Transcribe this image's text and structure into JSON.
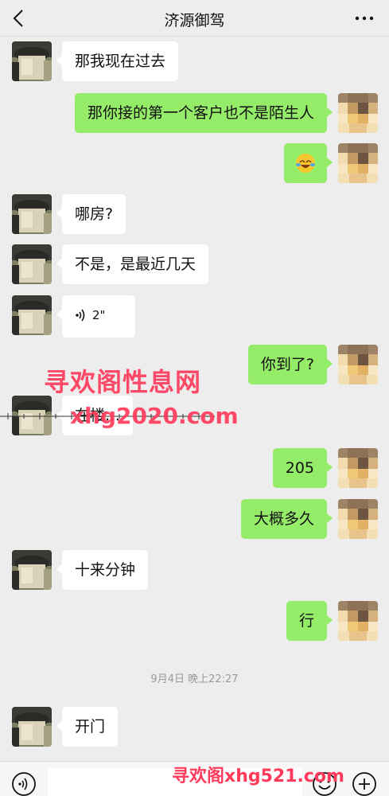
{
  "header": {
    "title": "济源御驾",
    "back_icon": "chevron-left-icon",
    "more_icon": "more-dots-icon"
  },
  "messages": [
    {
      "side": "left",
      "text": "那我现在过去"
    },
    {
      "side": "right",
      "text": "那你接的第一个客户也不是陌生人"
    },
    {
      "side": "right",
      "text": "",
      "emoji": "laughing-crying-emoji"
    },
    {
      "side": "left",
      "text": "哪房?"
    },
    {
      "side": "left",
      "text": "不是，是最近几天"
    },
    {
      "side": "left",
      "text": "2\"",
      "voice": true
    },
    {
      "side": "right",
      "text": "你到了?"
    },
    {
      "side": "left",
      "text": "在楼…"
    },
    {
      "side": "right",
      "text": "205"
    },
    {
      "side": "right",
      "text": "大概多久"
    },
    {
      "side": "left",
      "text": "十来分钟"
    },
    {
      "side": "right",
      "text": "行"
    },
    {
      "side": "left",
      "text": "开门"
    }
  ],
  "timestamp": "9月4日 晚上22:27",
  "watermarks": {
    "line1": "寻欢阁性息网",
    "line2": "xhg2020.com",
    "line3": "寻欢阁xhg521.com"
  },
  "input_bar": {
    "voice_icon": "voice-icon",
    "emoji_icon": "emoji-icon",
    "plus_icon": "plus-icon"
  },
  "colors": {
    "background": "#ededed",
    "bubble_mine": "#95ec69",
    "bubble_other": "#ffffff",
    "watermark": "#ff3b5c"
  }
}
